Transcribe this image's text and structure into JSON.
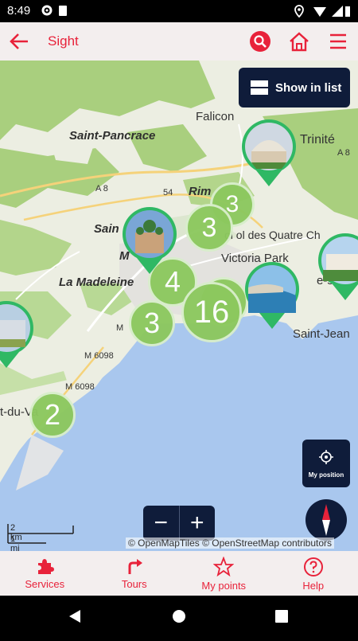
{
  "status": {
    "time": "8:49"
  },
  "appbar": {
    "title": "Sight"
  },
  "map": {
    "show_in_list_label": "Show in list",
    "my_position_label": "My position",
    "zoom_out_label": "−",
    "zoom_in_label": "+",
    "attribution": "© OpenMapTiles © OpenStreetMap contributors",
    "scale_km": "2 km",
    "scale_mi": "1 mi",
    "places": {
      "falicon": "Falicon",
      "saint_pancrace": "Saint-Pancrace",
      "trinite": "Trinité",
      "rimiez": "Rim",
      "saint_mo": "Sain",
      "col": "ol ol des Quatre Ch",
      "victoria_park": "Victoria Park",
      "la_madeleine": "La Madeleine",
      "saint_jean": "Saint-Jean",
      "mer_sur": "e-sur",
      "du_var": "t-du-Va",
      "mv": "M"
    },
    "roads": {
      "a8_left": "A 8",
      "a8_right": "A 8",
      "r54": "54",
      "m6098a": "M 6098",
      "m6098b": "M 6098",
      "m_small": "M"
    },
    "clusters": [
      "3",
      "3",
      "4",
      "16",
      "3",
      "3",
      "2"
    ]
  },
  "bottom_nav": [
    {
      "label": "Services",
      "icon": "puzzle-icon"
    },
    {
      "label": "Tours",
      "icon": "turn-arrow-icon"
    },
    {
      "label": "My points",
      "icon": "star-icon"
    },
    {
      "label": "Help",
      "icon": "help-icon"
    }
  ],
  "colors": {
    "accent": "#e8223a",
    "cluster": "#8cc85e",
    "dark_button": "#0f1c3a",
    "sea": "#a9c7ee"
  }
}
